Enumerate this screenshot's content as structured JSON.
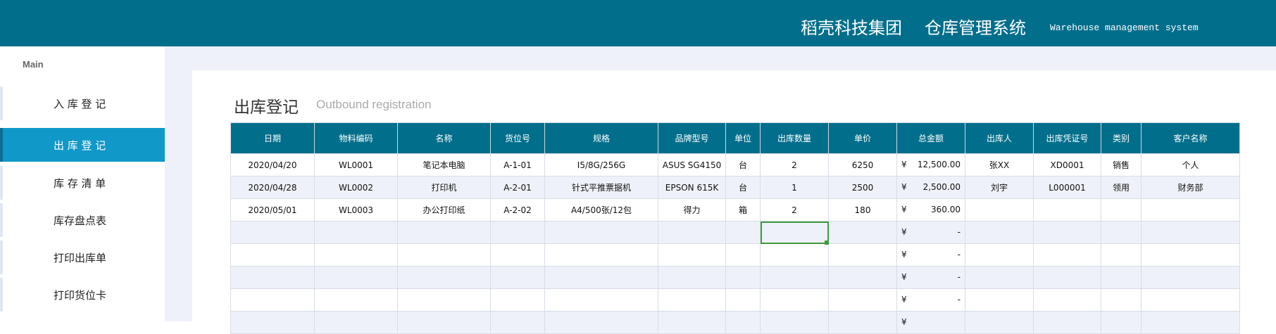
{
  "header": {
    "company": "稻壳科技集团",
    "system": "仓库管理系统",
    "english": "Warehouse management system",
    "bg_color": "#016f8c"
  },
  "sidebar": {
    "heading": "Main",
    "items": [
      {
        "label": "入 库  登 记",
        "active": false
      },
      {
        "label": "出 库  登 记",
        "active": true
      },
      {
        "label": "库 存  清 单",
        "active": false
      },
      {
        "label": "库存盘点表",
        "active": false
      },
      {
        "label": "打印出库单",
        "active": false
      },
      {
        "label": "打印货位卡",
        "active": false
      }
    ],
    "active_color": "#1098c8"
  },
  "page": {
    "title": "出库登记",
    "subtitle": "Outbound registration"
  },
  "table": {
    "columns": [
      "日期",
      "物料编码",
      "名称",
      "货位号",
      "规格",
      "品牌型号",
      "单位",
      "出库数量",
      "单价",
      "总金额",
      "出库人",
      "出库凭证号",
      "类别",
      "客户名称"
    ],
    "currency_symbol": "¥",
    "rows": [
      {
        "date": "2020/04/20",
        "code": "WL0001",
        "name": "笔记本电脑",
        "location": "A-1-01",
        "spec": "I5/8G/256G",
        "brand": "ASUS SG4150",
        "unit": "台",
        "qty": "2",
        "price": "6250",
        "total": "12,500.00",
        "person": "张XX",
        "voucher": "XD0001",
        "category": "销售",
        "customer": "个人"
      },
      {
        "date": "2020/04/28",
        "code": "WL0002",
        "name": "打印机",
        "location": "A-2-01",
        "spec": "针式平推票据机",
        "brand": "EPSON 615K",
        "unit": "台",
        "qty": "1",
        "price": "2500",
        "total": "2,500.00",
        "person": "刘宇",
        "voucher": "L000001",
        "category": "领用",
        "customer": "财务部"
      },
      {
        "date": "2020/05/01",
        "code": "WL0003",
        "name": "办公打印纸",
        "location": "A-2-02",
        "spec": "A4/500张/12包",
        "brand": "得力",
        "unit": "箱",
        "qty": "2",
        "price": "180",
        "total": "360.00",
        "person": "",
        "voucher": "",
        "category": "",
        "customer": ""
      },
      {
        "date": "",
        "code": "",
        "name": "",
        "location": "",
        "spec": "",
        "brand": "",
        "unit": "",
        "qty": "",
        "price": "",
        "total": "-",
        "person": "",
        "voucher": "",
        "category": "",
        "customer": ""
      },
      {
        "date": "",
        "code": "",
        "name": "",
        "location": "",
        "spec": "",
        "brand": "",
        "unit": "",
        "qty": "",
        "price": "",
        "total": "-",
        "person": "",
        "voucher": "",
        "category": "",
        "customer": ""
      },
      {
        "date": "",
        "code": "",
        "name": "",
        "location": "",
        "spec": "",
        "brand": "",
        "unit": "",
        "qty": "",
        "price": "",
        "total": "-",
        "person": "",
        "voucher": "",
        "category": "",
        "customer": ""
      },
      {
        "date": "",
        "code": "",
        "name": "",
        "location": "",
        "spec": "",
        "brand": "",
        "unit": "",
        "qty": "",
        "price": "",
        "total": "-",
        "person": "",
        "voucher": "",
        "category": "",
        "customer": ""
      },
      {
        "date": "",
        "code": "",
        "name": "",
        "location": "",
        "spec": "",
        "brand": "",
        "unit": "",
        "qty": "",
        "price": "",
        "total": "",
        "person": "",
        "voucher": "",
        "category": "",
        "customer": ""
      }
    ]
  }
}
